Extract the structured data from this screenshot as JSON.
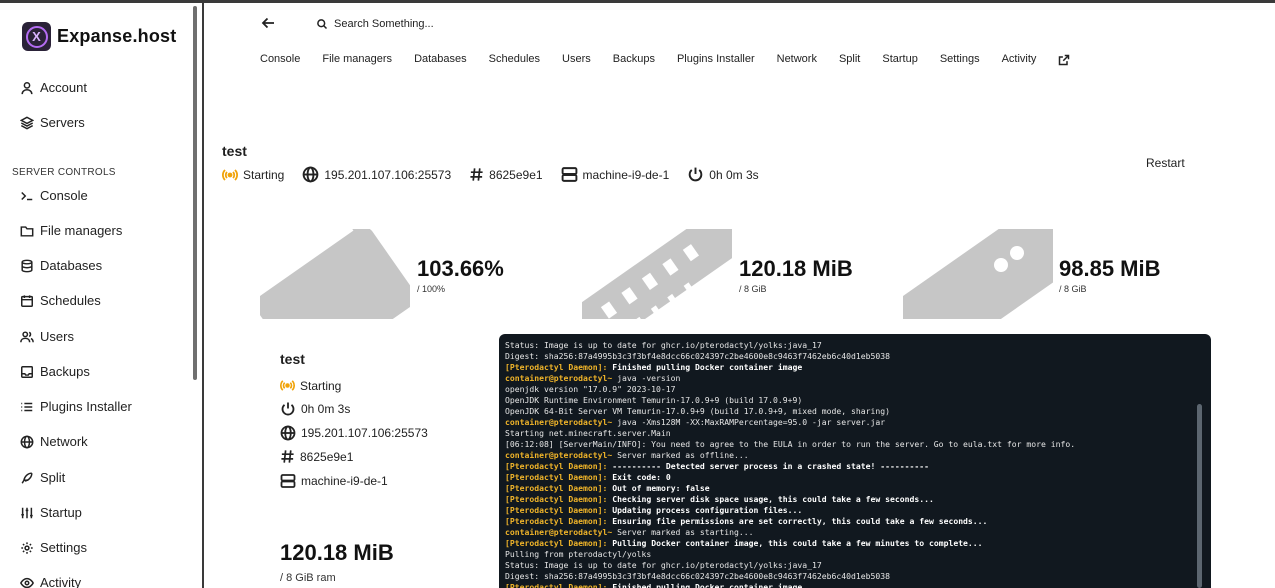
{
  "brand": {
    "name": "Expanse.host",
    "logo_letter": "X"
  },
  "sidebar": {
    "top_items": [
      {
        "label": "Account",
        "icon": "user-icon"
      },
      {
        "label": "Servers",
        "icon": "layers-icon"
      }
    ],
    "section_label": "SERVER CONTROLS",
    "items": [
      {
        "label": "Console",
        "icon": "terminal-icon"
      },
      {
        "label": "File managers",
        "icon": "folder-icon"
      },
      {
        "label": "Databases",
        "icon": "database-icon"
      },
      {
        "label": "Schedules",
        "icon": "calendar-icon"
      },
      {
        "label": "Users",
        "icon": "users-icon"
      },
      {
        "label": "Backups",
        "icon": "archive-icon"
      },
      {
        "label": "Plugins Installer",
        "icon": "list-icon"
      },
      {
        "label": "Network",
        "icon": "globe-icon"
      },
      {
        "label": "Split",
        "icon": "feather-icon"
      },
      {
        "label": "Startup",
        "icon": "sliders-icon"
      },
      {
        "label": "Settings",
        "icon": "gear-icon"
      },
      {
        "label": "Activity",
        "icon": "eye-icon"
      }
    ]
  },
  "header": {
    "search_placeholder": "Search Something...",
    "tabs": [
      "Console",
      "File managers",
      "Databases",
      "Schedules",
      "Users",
      "Backups",
      "Plugins Installer",
      "Network",
      "Split",
      "Startup",
      "Settings",
      "Activity"
    ]
  },
  "server": {
    "name": "test",
    "status": "Starting",
    "address": "195.201.107.106:25573",
    "id": "8625e9e1",
    "node": "machine-i9-de-1",
    "uptime": "0h 0m 3s",
    "restart_label": "Restart"
  },
  "stats": [
    {
      "value": "103.66%",
      "sub": "/ 100%"
    },
    {
      "value": "120.18 MiB",
      "sub": "/ 8 GiB"
    },
    {
      "value": "98.85 MiB",
      "sub": "/ 8 GiB"
    }
  ],
  "details": {
    "ram_value": "120.18 MiB",
    "ram_sub": "/ 8 GiB ram"
  },
  "colors": {
    "status_starting": "#f0a30a",
    "console_bg": "#11181f",
    "console_prefix": "#f0b429"
  },
  "console": {
    "lines": [
      {
        "p": "",
        "t": "Status: Image is up to date for ghcr.io/pterodactyl/yolks:java_17"
      },
      {
        "p": "",
        "t": "Digest: sha256:87a4995b3c3f3bf4e8dcc66c024397c2be4600e8c9463f7462eb6c40d1eb5038"
      },
      {
        "p": "[Pterodactyl Daemon]:",
        "t": " Finished pulling Docker container image",
        "bold": true
      },
      {
        "p": "container@pterodactyl~",
        "t": " java -version"
      },
      {
        "p": "",
        "t": "openjdk version \"17.0.9\" 2023-10-17"
      },
      {
        "p": "",
        "t": "OpenJDK Runtime Environment Temurin-17.0.9+9 (build 17.0.9+9)"
      },
      {
        "p": "",
        "t": "OpenJDK 64-Bit Server VM Temurin-17.0.9+9 (build 17.0.9+9, mixed mode, sharing)"
      },
      {
        "p": "container@pterodactyl~",
        "t": " java -Xms128M -XX:MaxRAMPercentage=95.0 -jar server.jar"
      },
      {
        "p": "",
        "t": "Starting net.minecraft.server.Main"
      },
      {
        "p": "",
        "t": "[06:12:08] [ServerMain/INFO]: You need to agree to the EULA in order to run the server. Go to eula.txt for more info."
      },
      {
        "p": "container@pterodactyl~",
        "t": " Server marked as offline..."
      },
      {
        "p": "[Pterodactyl Daemon]:",
        "t": " ---------- Detected server process in a crashed state! ----------",
        "bold": true
      },
      {
        "p": "[Pterodactyl Daemon]:",
        "t": " Exit code: 0",
        "bold": true
      },
      {
        "p": "[Pterodactyl Daemon]:",
        "t": " Out of memory: false",
        "bold": true
      },
      {
        "p": "[Pterodactyl Daemon]:",
        "t": " Checking server disk space usage, this could take a few seconds...",
        "bold": true
      },
      {
        "p": "[Pterodactyl Daemon]:",
        "t": " Updating process configuration files...",
        "bold": true
      },
      {
        "p": "[Pterodactyl Daemon]:",
        "t": " Ensuring file permissions are set correctly, this could take a few seconds...",
        "bold": true
      },
      {
        "p": "container@pterodactyl~",
        "t": " Server marked as starting..."
      },
      {
        "p": "[Pterodactyl Daemon]:",
        "t": " Pulling Docker container image, this could take a few minutes to complete...",
        "bold": true
      },
      {
        "p": "",
        "t": "Pulling from pterodactyl/yolks"
      },
      {
        "p": "",
        "t": "Status: Image is up to date for ghcr.io/pterodactyl/yolks:java_17"
      },
      {
        "p": "",
        "t": "Digest: sha256:87a4995b3c3f3bf4e8dcc66c024397c2be4600e8c9463f7462eb6c40d1eb5038"
      },
      {
        "p": "[Pterodactyl Daemon]:",
        "t": " Finished pulling Docker container image",
        "bold": true
      }
    ]
  }
}
